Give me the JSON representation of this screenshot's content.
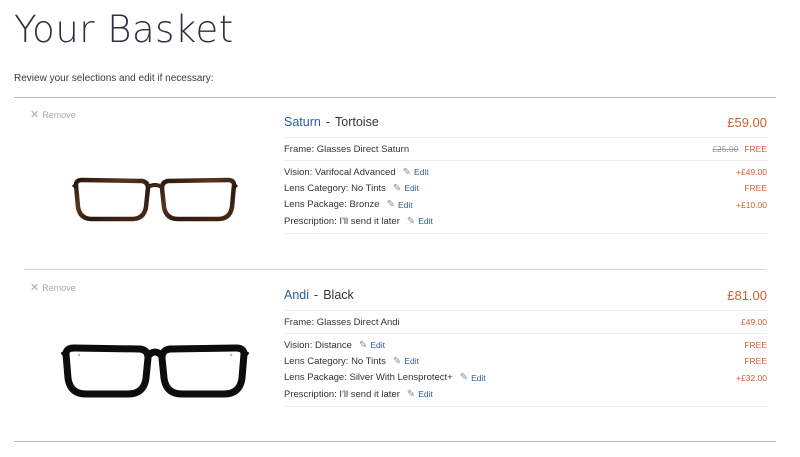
{
  "page": {
    "title": "Your Basket",
    "subtitle": "Review your selections and edit if necessary:"
  },
  "items": [
    {
      "remove_label": "Remove",
      "model": "Saturn",
      "separator": "-",
      "colour": "Tortoise",
      "price": "£59.00",
      "frame_label": "Frame: Glasses Direct Saturn",
      "frame_old_price": "£25.00",
      "frame_price": "FREE",
      "frame_colour": "#3a2418",
      "options": [
        {
          "label": "Vision: Varifocal Advanced",
          "edit": "Edit",
          "price": "+£49.00"
        },
        {
          "label": "Lens Category: No Tints",
          "edit": "Edit",
          "price": "FREE"
        },
        {
          "label": "Lens Package: Bronze",
          "edit": "Edit",
          "price": "+£10.00"
        },
        {
          "label": "Prescription: I'll send it later",
          "edit": "Edit",
          "price": ""
        }
      ]
    },
    {
      "remove_label": "Remove",
      "model": "Andi",
      "separator": "-",
      "colour": "Black",
      "price": "£81.00",
      "frame_label": "Frame: Glasses Direct Andi",
      "frame_old_price": "",
      "frame_price": "£49.00",
      "frame_colour": "#0d0d0d",
      "options": [
        {
          "label": "Vision: Distance",
          "edit": "Edit",
          "price": "FREE"
        },
        {
          "label": "Lens Category: No Tints",
          "edit": "Edit",
          "price": "FREE"
        },
        {
          "label": "Lens Package: Silver With Lensprotect+",
          "edit": "Edit",
          "price": "+£32.00"
        },
        {
          "label": "Prescription: I'll send it later",
          "edit": "Edit",
          "price": ""
        }
      ]
    }
  ],
  "colors": {
    "link": "#2b5b9c",
    "price": "#d25f2e"
  }
}
